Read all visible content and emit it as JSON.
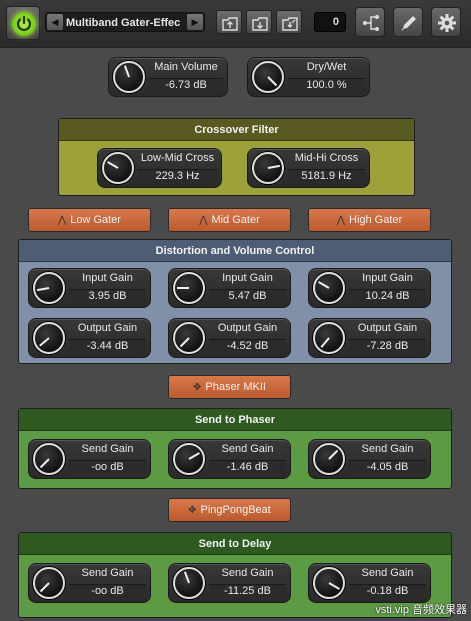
{
  "toolbar": {
    "preset_name": "Multiband Gater-Effec",
    "counter": "0",
    "icons": [
      "power-icon",
      "prev-arrow-icon",
      "next-arrow-icon",
      "import-icon",
      "export-icon",
      "save-icon",
      "routing-icon",
      "edit-icon",
      "settings-icon"
    ]
  },
  "main": {
    "main_volume": {
      "label": "Main Volume",
      "value": "-6.73 dB"
    },
    "dry_wet": {
      "label": "Dry/Wet",
      "value": "100.0 %"
    }
  },
  "crossover": {
    "title": "Crossover Filter",
    "low_mid": {
      "label": "Low-Mid Cross",
      "value": "229.3 Hz"
    },
    "mid_hi": {
      "label": "Mid-Hi Cross",
      "value": "5181.9 Hz"
    }
  },
  "gaters": {
    "low": "Low Gater",
    "mid": "Mid Gater",
    "high": "High Gater"
  },
  "distortion": {
    "title": "Distortion and Volume Control",
    "input": [
      {
        "label": "Input Gain",
        "value": "3.95 dB"
      },
      {
        "label": "Input Gain",
        "value": "5.47 dB"
      },
      {
        "label": "Input Gain",
        "value": "10.24 dB"
      }
    ],
    "output": [
      {
        "label": "Output Gain",
        "value": "-3.44 dB"
      },
      {
        "label": "Output Gain",
        "value": "-4.52 dB"
      },
      {
        "label": "Output Gain",
        "value": "-7.28 dB"
      }
    ]
  },
  "phaser_button": "Phaser MKII",
  "send_phaser": {
    "title": "Send to Phaser",
    "knobs": [
      {
        "label": "Send Gain",
        "value": "-oo dB"
      },
      {
        "label": "Send Gain",
        "value": "-1.46 dB"
      },
      {
        "label": "Send Gain",
        "value": "-4.05 dB"
      }
    ]
  },
  "pingpong_button": "PingPongBeat",
  "send_delay": {
    "title": "Send to Delay",
    "knobs": [
      {
        "label": "Send Gain",
        "value": "-oo dB"
      },
      {
        "label": "Send Gain",
        "value": "-11.25 dB"
      },
      {
        "label": "Send Gain",
        "value": "-0.18 dB"
      }
    ]
  },
  "watermark": "vsti.vip 音频效果器",
  "colors": {
    "power_green": "#8fdc2a",
    "crossover_panel": "#9ea03a",
    "distortion_panel": "#8090a8",
    "send_panel": "#5d9a44",
    "orange_button": "#cf6a3a"
  }
}
